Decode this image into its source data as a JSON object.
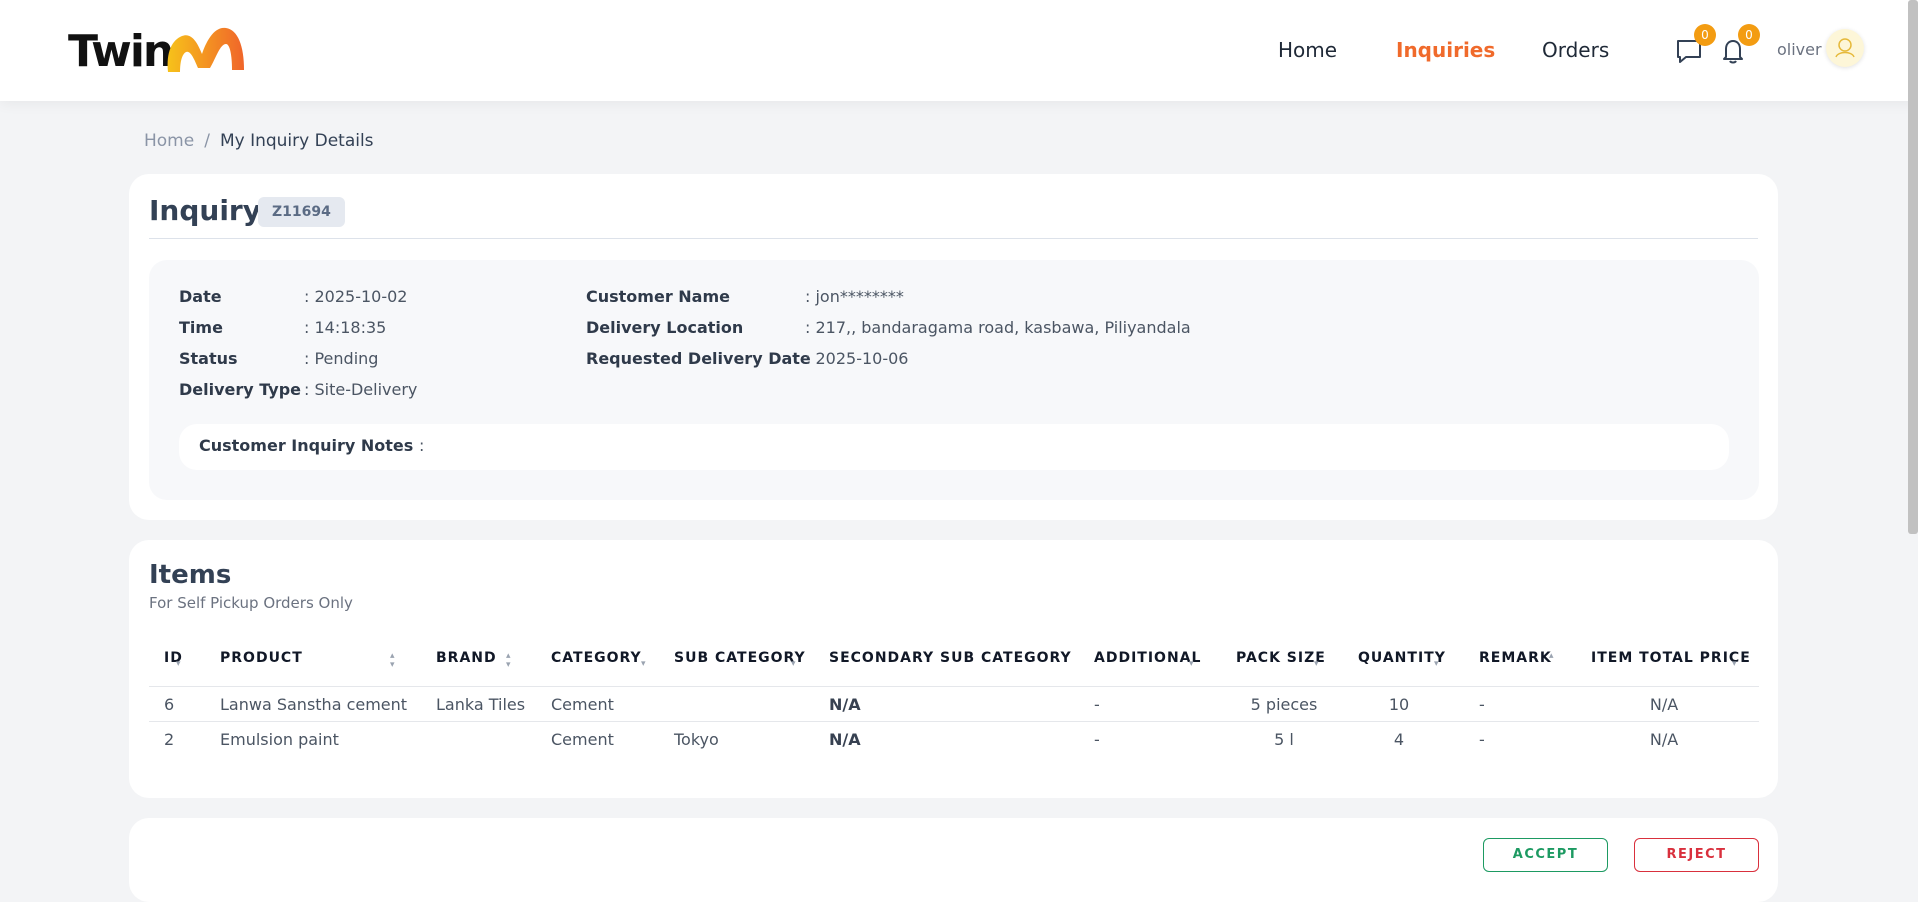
{
  "header": {
    "logo_text": "Twin",
    "nav": [
      {
        "label": "Home"
      },
      {
        "label": "Inquiries"
      },
      {
        "label": "Orders"
      }
    ],
    "messages_count": "0",
    "notifications_count": "0",
    "user_name": "oliver",
    "accent_color": "#f06a2b"
  },
  "breadcrumb": {
    "home": "Home",
    "separator": "/",
    "current": "My Inquiry Details"
  },
  "inquiry": {
    "title": "Inquiry",
    "id": "Z11694",
    "details_left": [
      {
        "label": "Date",
        "value": ": 2025-10-02"
      },
      {
        "label": "Time",
        "value": ": 14:18:35"
      },
      {
        "label": "Status",
        "value": ": Pending"
      },
      {
        "label": "Delivery Type",
        "value": ": Site-Delivery"
      }
    ],
    "details_right": [
      {
        "label": "Customer Name",
        "value": ": jon********"
      },
      {
        "label": "Delivery Location",
        "value": ": 217,, bandaragama road, kasbawa, Piliyandala"
      },
      {
        "label": "Requested Delivery Date",
        "value": ": 2025-10-06"
      }
    ],
    "notes_label": "Customer Inquiry Notes",
    "notes_value": ":"
  },
  "items": {
    "title": "Items",
    "subtitle": "For Self Pickup Orders Only",
    "columns": [
      "ID",
      "PRODUCT",
      "BRAND",
      "CATEGORY",
      "SUB CATEGORY",
      "SECONDARY SUB CATEGORY",
      "ADDITIONAL",
      "PACK SIZE",
      "QUANTITY",
      "REMARK",
      "ITEM TOTAL PRICE"
    ],
    "rows": [
      [
        "6",
        "Lanwa Sanstha cement",
        "Lanka Tiles",
        "Cement",
        "",
        "N/A",
        "-",
        "5 pieces",
        "10",
        "-",
        "N/A"
      ],
      [
        "2",
        "Emulsion paint",
        "",
        "Cement",
        "Tokyo",
        "N/A",
        "-",
        "5 l",
        "4",
        "-",
        "N/A"
      ]
    ]
  },
  "actions": {
    "accept": "ACCEPT",
    "reject": "REJECT"
  }
}
